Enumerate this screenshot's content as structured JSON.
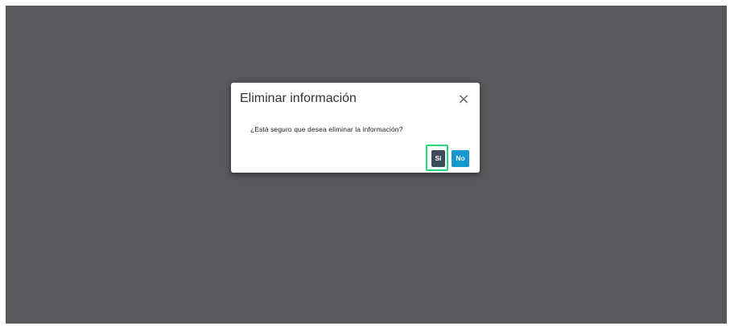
{
  "dialog": {
    "title": "Eliminar información",
    "close_icon": "close-icon",
    "close_glyph": "×",
    "message": "¿Está seguro que desea eliminar la información?",
    "buttons": {
      "yes_label": "Si",
      "no_label": "No"
    }
  },
  "colors": {
    "overlay": "#59585c",
    "yes_button": "#3d4a5a",
    "no_button": "#1597cf",
    "focus_ring": "#28d77a"
  }
}
